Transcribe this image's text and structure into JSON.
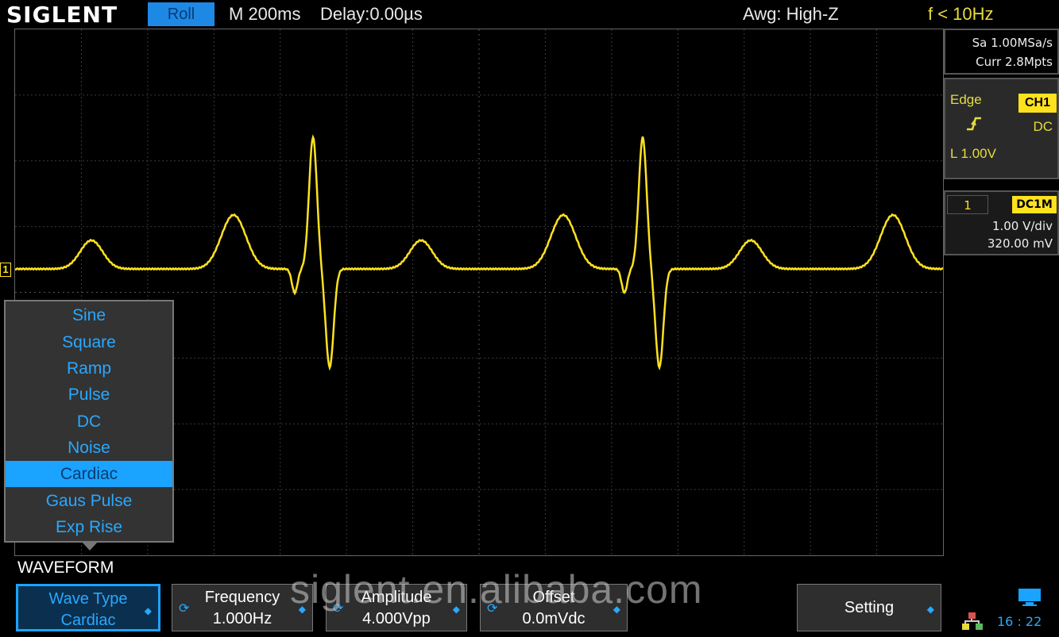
{
  "header": {
    "brand": "SIGLENT",
    "mode": "Roll",
    "timebase": "M 200ms",
    "delay": "Delay:0.00µs",
    "awg_load": "Awg: High-Z",
    "frequency": "f < 10Hz"
  },
  "acquisition": {
    "sample_rate": "Sa 1.00MSa/s",
    "current_depth": "Curr 2.8Mpts"
  },
  "trigger": {
    "type": "Edge",
    "source": "CH1",
    "coupling": "DC",
    "level": "L 1.00V"
  },
  "channel": {
    "number": "1",
    "impedance": "DC1M",
    "scale": "1.00 V/div",
    "offset": "320.00 mV",
    "marker": "1"
  },
  "waveform_menu": {
    "label": "WAVEFORM",
    "items": [
      "Sine",
      "Square",
      "Ramp",
      "Pulse",
      "DC",
      "Noise",
      "Cardiac",
      "Gaus Pulse",
      "Exp Rise"
    ],
    "selected": "Cardiac"
  },
  "softkeys": {
    "wave_type": {
      "label": "Wave Type",
      "value": "Cardiac"
    },
    "frequency": {
      "label": "Frequency",
      "value": "1.000Hz"
    },
    "amplitude": {
      "label": "Amplitude",
      "value": "4.000Vpp"
    },
    "offset": {
      "label": "Offset",
      "value": "0.0mVdc"
    },
    "setting": {
      "label": "Setting"
    }
  },
  "status": {
    "time": "16 : 22"
  },
  "watermark": "siglent.en.alibaba.com",
  "colors": {
    "trace": "#ffe21f",
    "accent": "#1aa3ff",
    "trigger_text": "#e6dc3c"
  },
  "icons": {
    "softkey_arrow": "diamond-arrow-icon",
    "softkey_knob": "rotary-knob-icon",
    "trigger_edge": "rising-edge-icon",
    "display": "monitor-icon",
    "network": "network-icon"
  }
}
